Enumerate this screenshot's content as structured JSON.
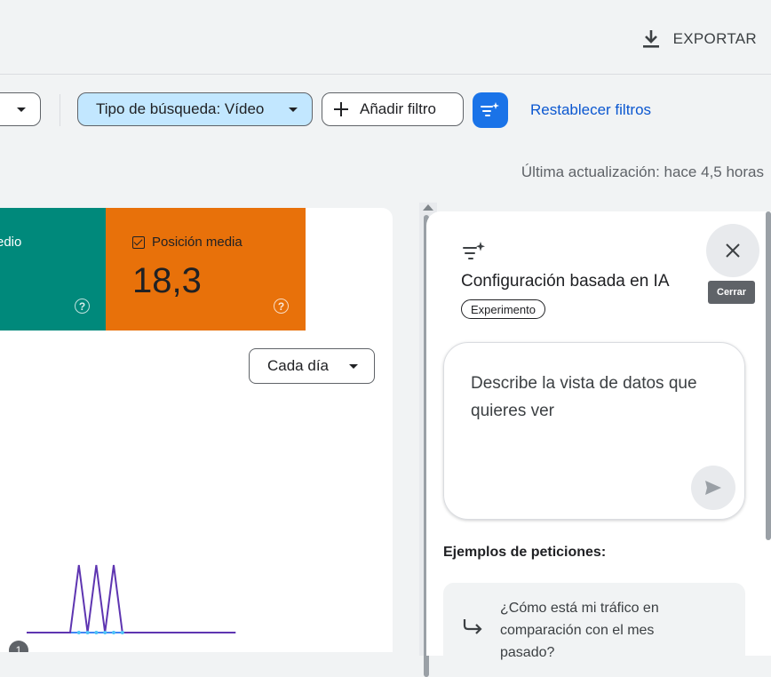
{
  "header": {
    "export_label": "EXPORTAR",
    "export_icon": "download-icon"
  },
  "filters": {
    "search_type_label": "Tipo de búsqueda: Vídeo",
    "add_filter_label": "Añadir filtro",
    "ai_config_icon": "sparkle-filter-icon",
    "reset_label": "Restablecer filtros"
  },
  "status": {
    "last_update": "Última actualización: hace 4,5 horas"
  },
  "metrics": {
    "ctr_label_partial": "edio",
    "position_label": "Posición media",
    "position_value": "18,3",
    "ctr_color": "#00897b",
    "position_color": "#e8710a"
  },
  "chart_controls": {
    "granularity": "Cada día",
    "annotation_number": "1"
  },
  "chart_data": {
    "type": "line",
    "series": [
      {
        "values": [
          0,
          0,
          0,
          0,
          0,
          0,
          1,
          0,
          1,
          0,
          1,
          0,
          0,
          0,
          0,
          0,
          0,
          0,
          0,
          0,
          0,
          0,
          0,
          0,
          0
        ],
        "color": "#5e35b1"
      },
      {
        "values": [
          0,
          0,
          0,
          0,
          0,
          0,
          0,
          0,
          0,
          0,
          0,
          0,
          0,
          0,
          0,
          0,
          0,
          0,
          0,
          0,
          0,
          0,
          0,
          0,
          0
        ],
        "color": "#4285f4"
      }
    ]
  },
  "ai_panel": {
    "title": "Configuración basada en IA",
    "badge": "Experimento",
    "close_tooltip": "Cerrar",
    "prompt_placeholder": "Describe la vista de datos que quieres ver",
    "examples_title": "Ejemplos de peticiones:",
    "example_1": "¿Cómo está mi tráfico en comparación con el mes pasado?"
  }
}
